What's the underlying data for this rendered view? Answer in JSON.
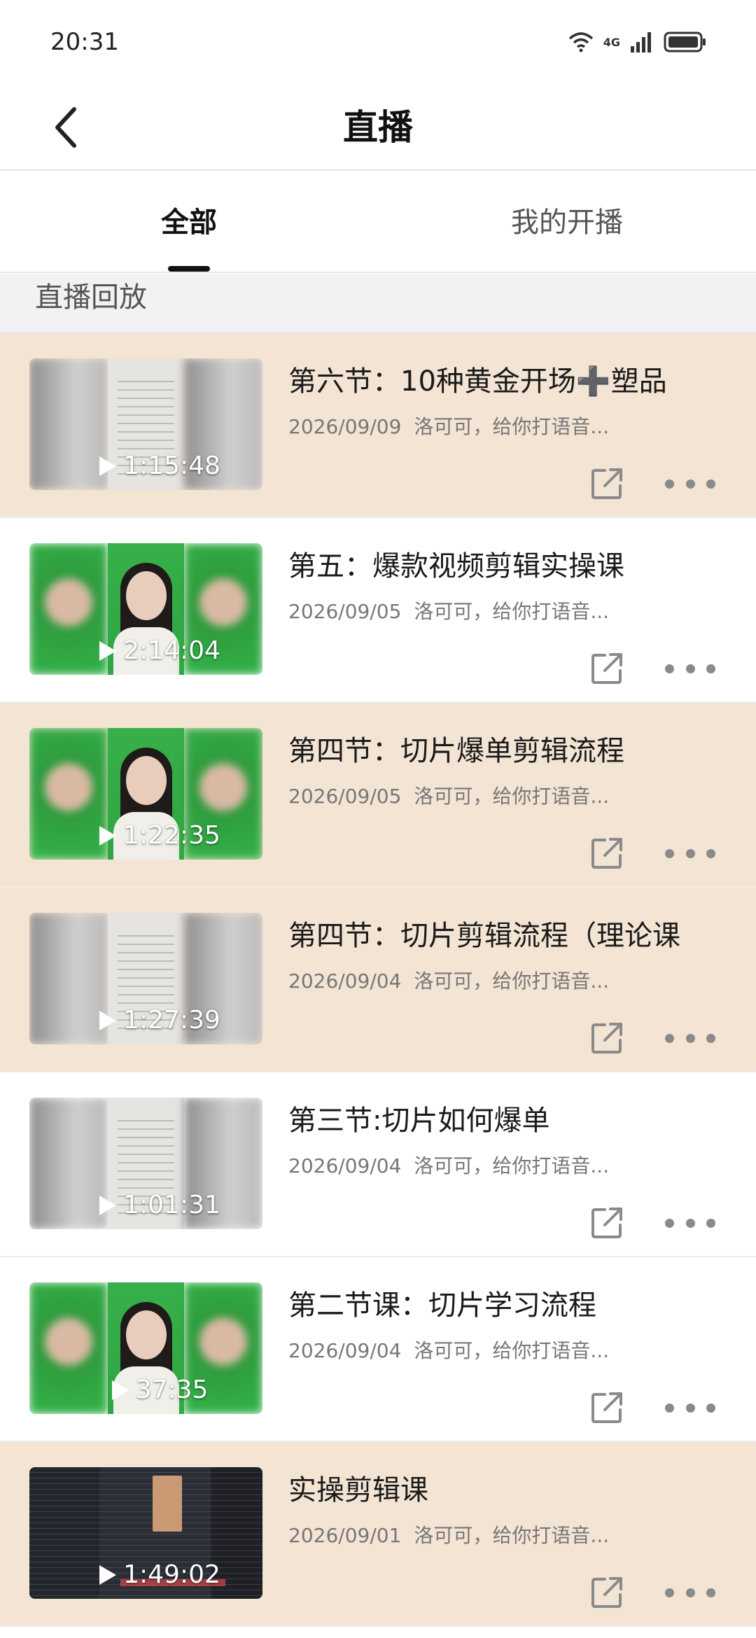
{
  "status_bar": {
    "time": "20:31",
    "network": "4G"
  },
  "header": {
    "title": "直播"
  },
  "tabs": [
    {
      "label": "全部",
      "active": true
    },
    {
      "label": "我的开播",
      "active": false
    }
  ],
  "section": {
    "title": "直播回放"
  },
  "colors": {
    "highlight_row": "#f3e4d4",
    "accent": "#111111"
  },
  "replays": [
    {
      "title": "第六节：10种黄金开场➕塑品",
      "date": "2026/09/09",
      "author": "洛可可，给你打语音...",
      "duration": "1:15:48",
      "thumb": "doc",
      "highlight": true
    },
    {
      "title": "第五：爆款视频剪辑实操课",
      "date": "2026/09/05",
      "author": "洛可可，给你打语音...",
      "duration": "2:14:04",
      "thumb": "green",
      "highlight": false
    },
    {
      "title": "第四节：切片爆单剪辑流程",
      "date": "2026/09/05",
      "author": "洛可可，给你打语音...",
      "duration": "1:22:35",
      "thumb": "green",
      "highlight": true
    },
    {
      "title": "第四节：切片剪辑流程（理论课",
      "date": "2026/09/04",
      "author": "洛可可，给你打语音...",
      "duration": "1:27:39",
      "thumb": "doc",
      "highlight": true
    },
    {
      "title": "第三节:切片如何爆单",
      "date": "2026/09/04",
      "author": "洛可可，给你打语音...",
      "duration": "1:01:31",
      "thumb": "doc",
      "highlight": false
    },
    {
      "title": "第二节课：切片学习流程",
      "date": "2026/09/04",
      "author": "洛可可，给你打语音...",
      "duration": "37:35",
      "thumb": "green",
      "highlight": false
    },
    {
      "title": "实操剪辑课",
      "date": "2026/09/01",
      "author": "洛可可，给你打语音...",
      "duration": "1:49:02",
      "thumb": "dark",
      "highlight": true
    }
  ]
}
